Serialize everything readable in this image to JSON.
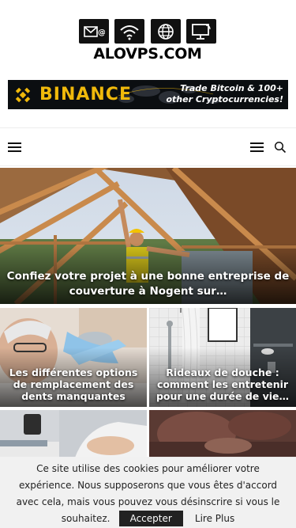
{
  "site": {
    "logo_text": "ALOVPS.COM",
    "logo_icons": [
      "email-icon",
      "wifi-icon",
      "globe-icon",
      "monitor-icon"
    ]
  },
  "banner": {
    "brand": "BINANCE",
    "promo": "Trade Bitcoin & 100+ other Cryptocurrencies!",
    "brand_color": "#f0b90b"
  },
  "nav": {
    "left_icon": "hamburger-icon",
    "right_icons": [
      "menu-icon",
      "search-icon"
    ]
  },
  "hero": {
    "title": "Confiez votre projet à une bonne entreprise de couverture à Nogent sur…"
  },
  "cards": [
    {
      "title": "Les différentes options de remplacement des dents manquantes"
    },
    {
      "title": "Rideaux de douche : comment les entretenir pour une durée de vie…"
    },
    {
      "title": ""
    },
    {
      "title": ""
    }
  ],
  "cookie": {
    "message": "Ce site utilise des cookies pour améliorer votre expérience. Nous supposerons que vous êtes d'accord avec cela, mais vous pouvez vous désinscrire si vous le souhaitez.",
    "accept_label": "Accepter",
    "more_label": "Lire Plus"
  }
}
